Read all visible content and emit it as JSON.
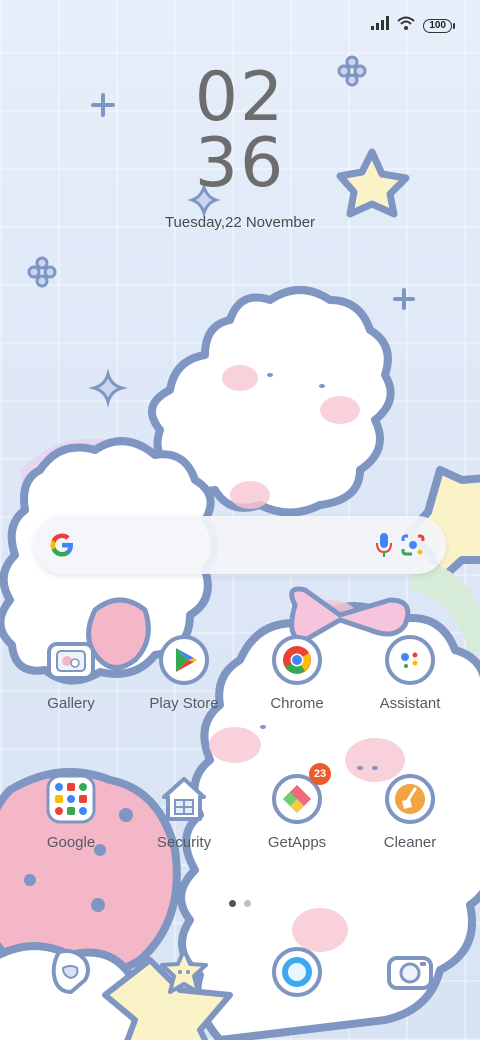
{
  "status_bar": {
    "battery": "100",
    "icons": [
      "signal-icon",
      "wifi-icon",
      "battery-icon"
    ]
  },
  "lock": {
    "hour": "02",
    "minute": "36",
    "date": "Tuesday,22 November"
  },
  "search_bar": {
    "icons": [
      "google-g-icon",
      "microphone-icon",
      "lens-camera-icon"
    ]
  },
  "apps": [
    {
      "label": "Gallery",
      "icon": "gallery-icon"
    },
    {
      "label": "Play Store",
      "icon": "play-store-icon"
    },
    {
      "label": "Chrome",
      "icon": "chrome-icon"
    },
    {
      "label": "Assistant",
      "icon": "assistant-icon"
    },
    {
      "label": "Google",
      "icon": "google-folder-icon"
    },
    {
      "label": "Security",
      "icon": "security-house-icon"
    },
    {
      "label": "GetApps",
      "icon": "getapps-icon",
      "badge": "23"
    },
    {
      "label": "Cleaner",
      "icon": "cleaner-broom-icon"
    }
  ],
  "page_indicator": {
    "pages": 2,
    "active_page": 1
  },
  "dock": [
    {
      "icon": "phone-icon"
    },
    {
      "icon": "messages-star-icon"
    },
    {
      "icon": "browser-icon"
    },
    {
      "icon": "camera-icon"
    }
  ],
  "colors": {
    "outline": "#7f95c2",
    "sheep_white": "#ffffff",
    "pink": "#f3b7c8",
    "star_yellow": "#fbf3c8",
    "badge": "#ef5a2a"
  }
}
